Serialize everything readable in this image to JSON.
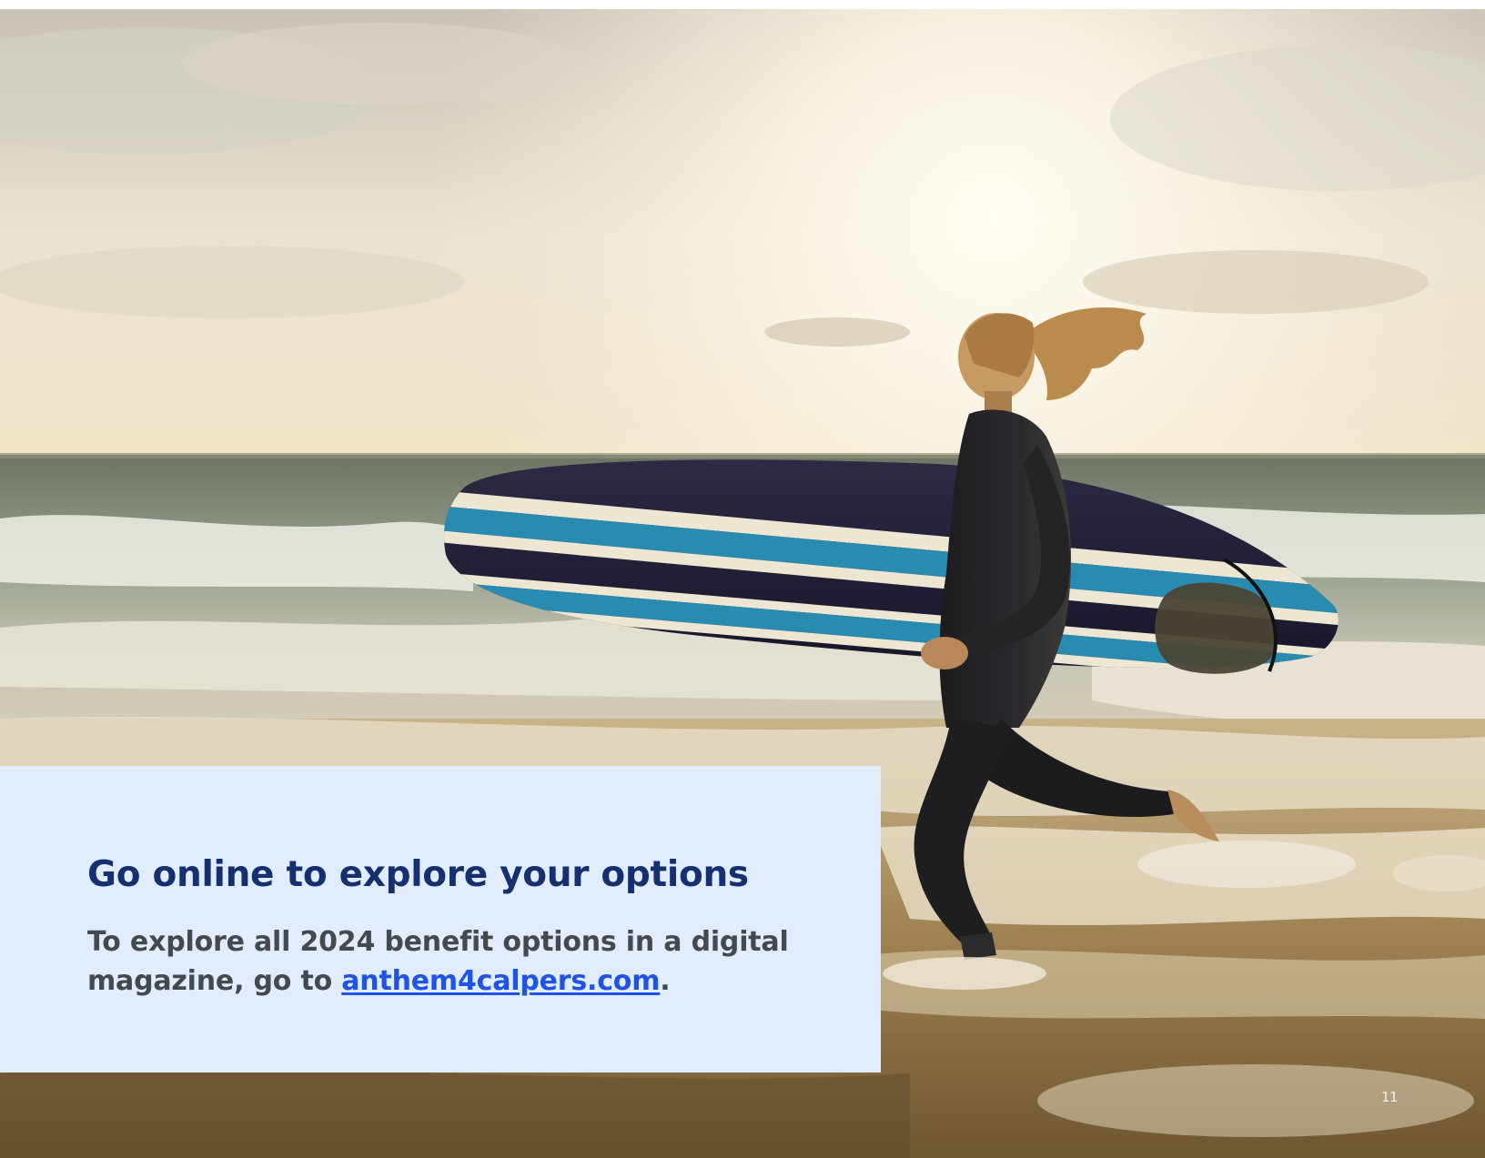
{
  "callout": {
    "title": "Go online to explore your options",
    "body_lead": "To explore all 2024 benefit options in a digital magazine, go to ",
    "link_text": "anthem4calpers.com",
    "body_end": "."
  },
  "photo": {
    "subject": "surfer-running-with-surfboard"
  },
  "page_number": "11",
  "colors": {
    "callout_background": "#e1ecfd",
    "title": "#16306f",
    "body_text": "#444950",
    "link": "#1f53e6"
  }
}
